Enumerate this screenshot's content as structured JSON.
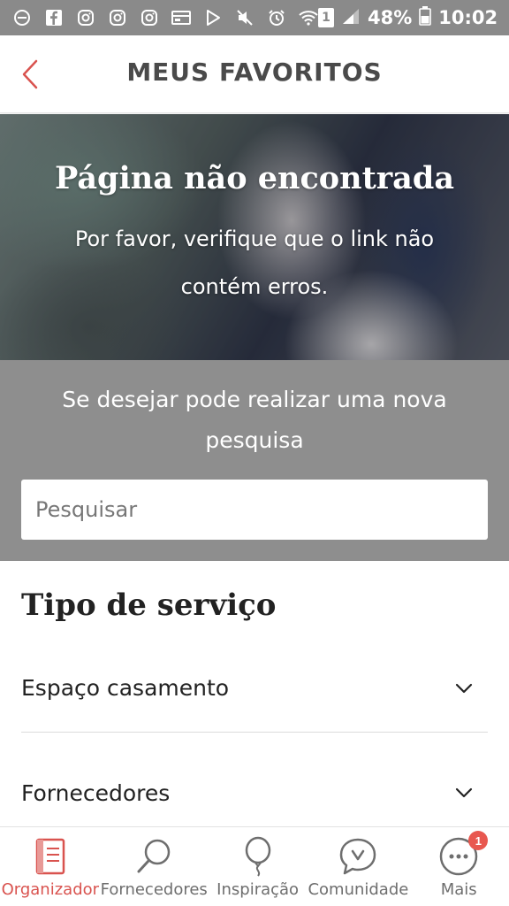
{
  "status_bar": {
    "battery": "48%",
    "time": "10:02",
    "sim_slot": "1",
    "icons": [
      "minus-circle-icon",
      "facebook-icon",
      "instagram-icon",
      "instagram-icon",
      "instagram-icon",
      "card-icon",
      "play-store-icon",
      "mute-icon",
      "alarm-icon",
      "wifi-icon",
      "sim-icon",
      "signal-icon",
      "battery-icon"
    ]
  },
  "header": {
    "title": "MEUS FAVORITOS",
    "back_icon": "chevron-left-icon"
  },
  "hero": {
    "title": "Página não encontrada",
    "subtitle": "Por favor, verifique que o link não contém erros."
  },
  "search": {
    "prompt": "Se desejar pode realizar uma nova pesquisa",
    "placeholder": "Pesquisar"
  },
  "filters": {
    "title": "Tipo de serviço",
    "items": [
      {
        "label": "Espaço casamento",
        "icon": "chevron-down-icon"
      },
      {
        "label": "Fornecedores",
        "icon": "chevron-down-icon"
      }
    ]
  },
  "bottom_nav": {
    "items": [
      {
        "label": "Organizador",
        "icon": "notebook-icon",
        "active": true
      },
      {
        "label": "Fornecedores",
        "icon": "search-icon",
        "active": false
      },
      {
        "label": "Inspiração",
        "icon": "balloon-icon",
        "active": false
      },
      {
        "label": "Comunidade",
        "icon": "chat-icon",
        "active": false
      },
      {
        "label": "Mais",
        "icon": "more-icon",
        "active": false,
        "badge": "1"
      }
    ]
  },
  "colors": {
    "accent": "#d9534f",
    "status_bar": "#8a8a8a",
    "search_band": "#8e8e8e"
  }
}
